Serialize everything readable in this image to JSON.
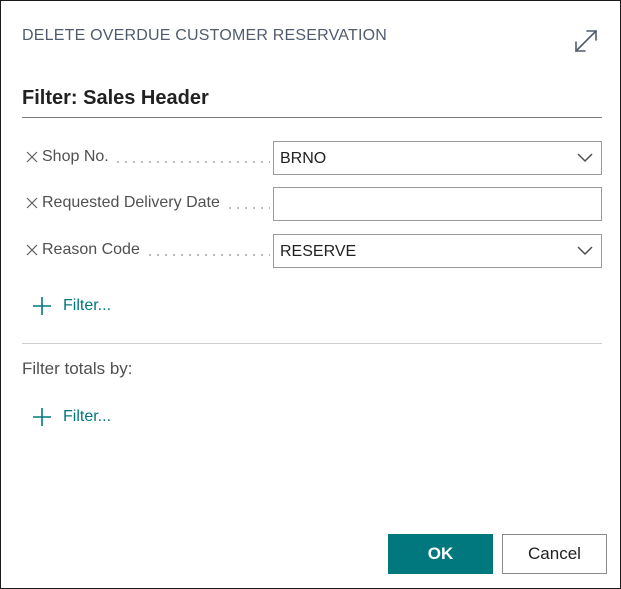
{
  "dialog": {
    "title": "DELETE OVERDUE CUSTOMER RESERVATION",
    "expand_icon": "expand-arrows-icon"
  },
  "filter_section": {
    "title": "Filter: Sales Header",
    "fields": [
      {
        "label": "Shop No.",
        "value": "BRNO",
        "type": "dropdown"
      },
      {
        "label": "Requested Delivery Date",
        "value": "",
        "type": "text"
      },
      {
        "label": "Reason Code",
        "value": "RESERVE",
        "type": "dropdown"
      }
    ],
    "add_filter_label": "Filter..."
  },
  "totals_section": {
    "label": "Filter totals by:",
    "add_filter_label": "Filter..."
  },
  "buttons": {
    "ok": "OK",
    "cancel": "Cancel"
  },
  "colors": {
    "accent": "#00787d",
    "title_text": "#505c6d"
  }
}
